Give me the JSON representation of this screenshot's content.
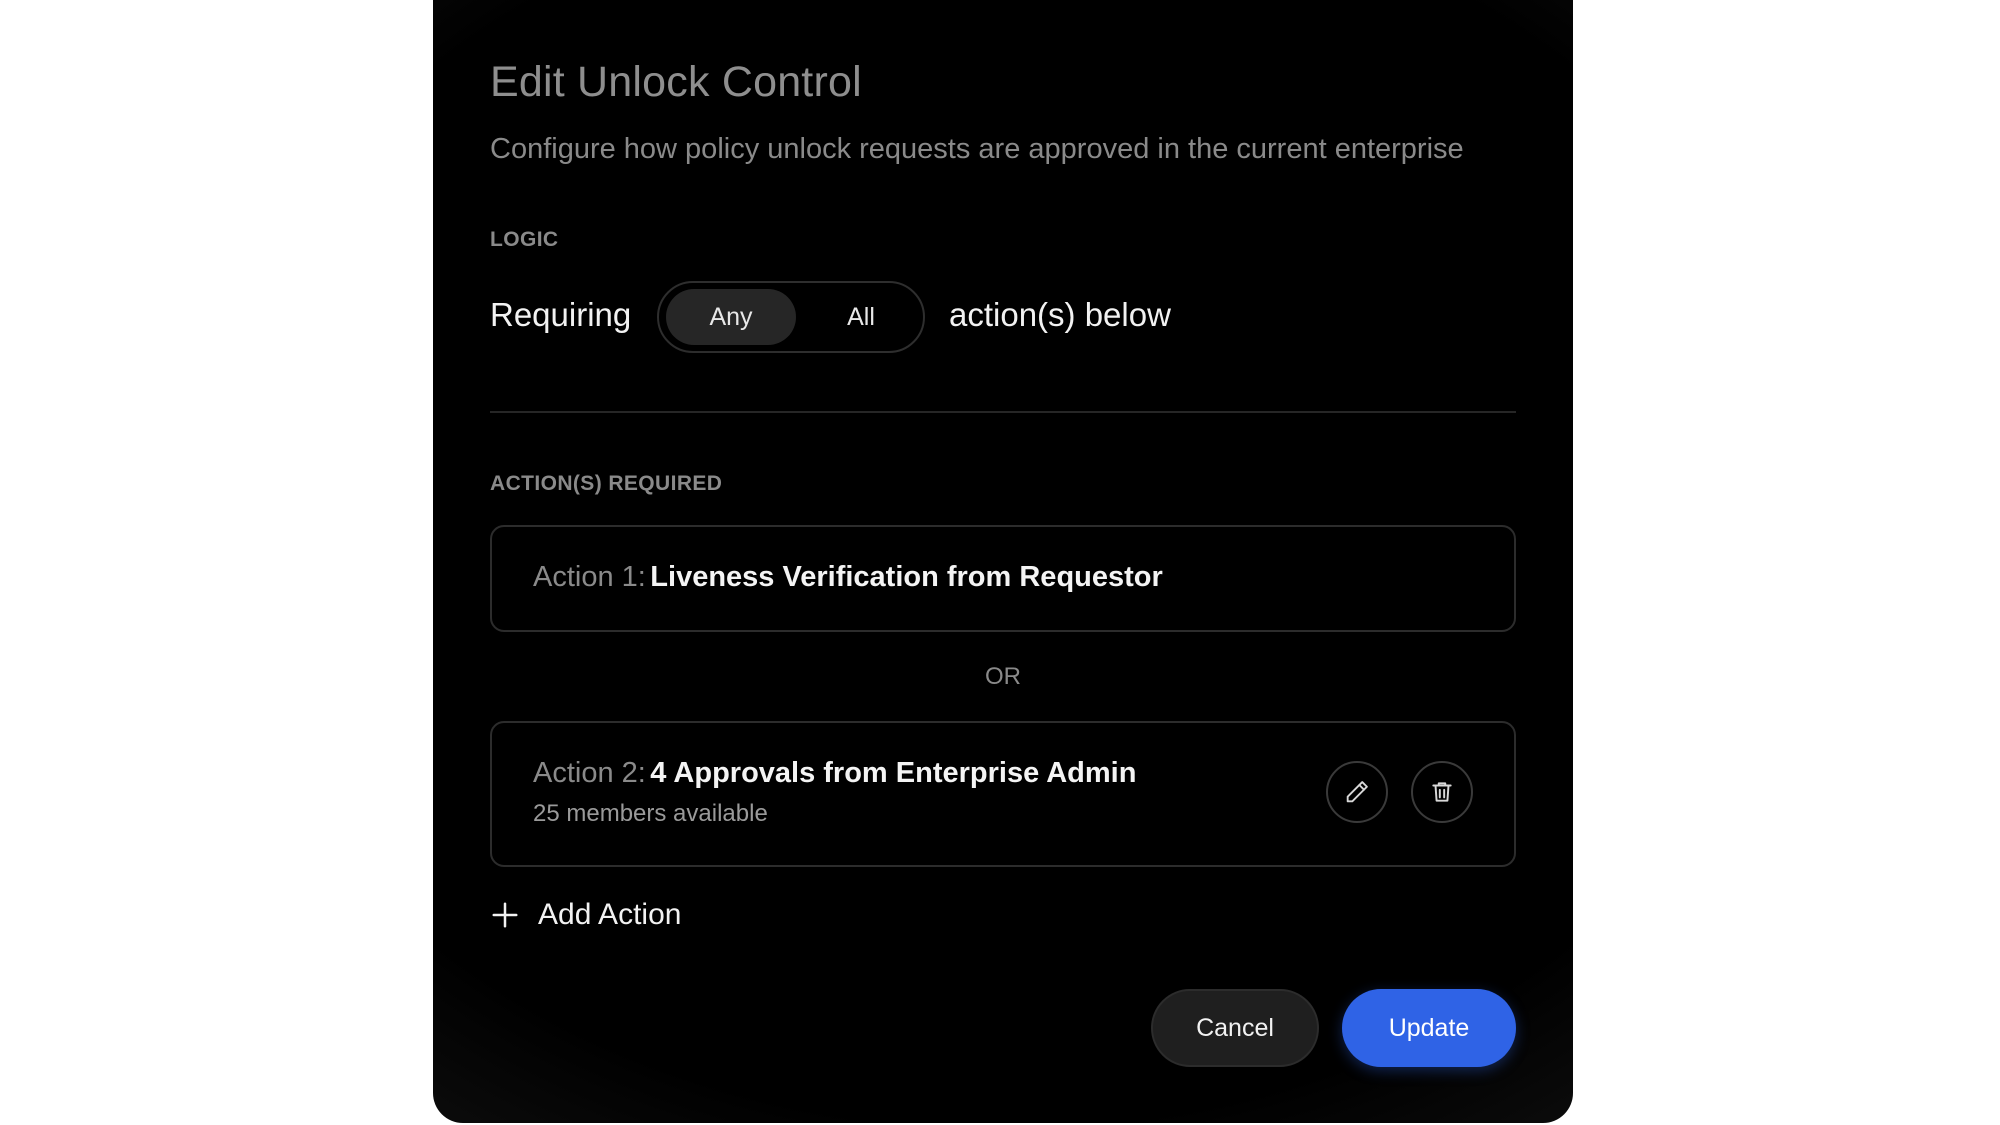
{
  "dialog": {
    "title": "Edit Unlock Control",
    "subtitle": "Configure how policy unlock requests are approved in the current enterprise"
  },
  "logic": {
    "section_label": "LOGIC",
    "prefix": "Requiring",
    "options": [
      {
        "label": "Any",
        "selected": true
      },
      {
        "label": "All",
        "selected": false
      }
    ],
    "suffix": "action(s) below"
  },
  "actions": {
    "section_label": "ACTION(S) REQUIRED",
    "separator": "OR",
    "items": [
      {
        "prefix": "Action 1:",
        "title": "Liveness Verification from Requestor"
      },
      {
        "prefix": "Action 2:",
        "title": "4 Approvals from Enterprise Admin",
        "subtitle": "25 members available",
        "controls": [
          "pencil-icon",
          "trash-icon"
        ]
      }
    ],
    "add_label": "Add Action"
  },
  "footer": {
    "cancel_label": "Cancel",
    "update_label": "Update"
  },
  "colors": {
    "accent": "#2f63e6",
    "background": "#000000",
    "page": "#ffffff"
  }
}
